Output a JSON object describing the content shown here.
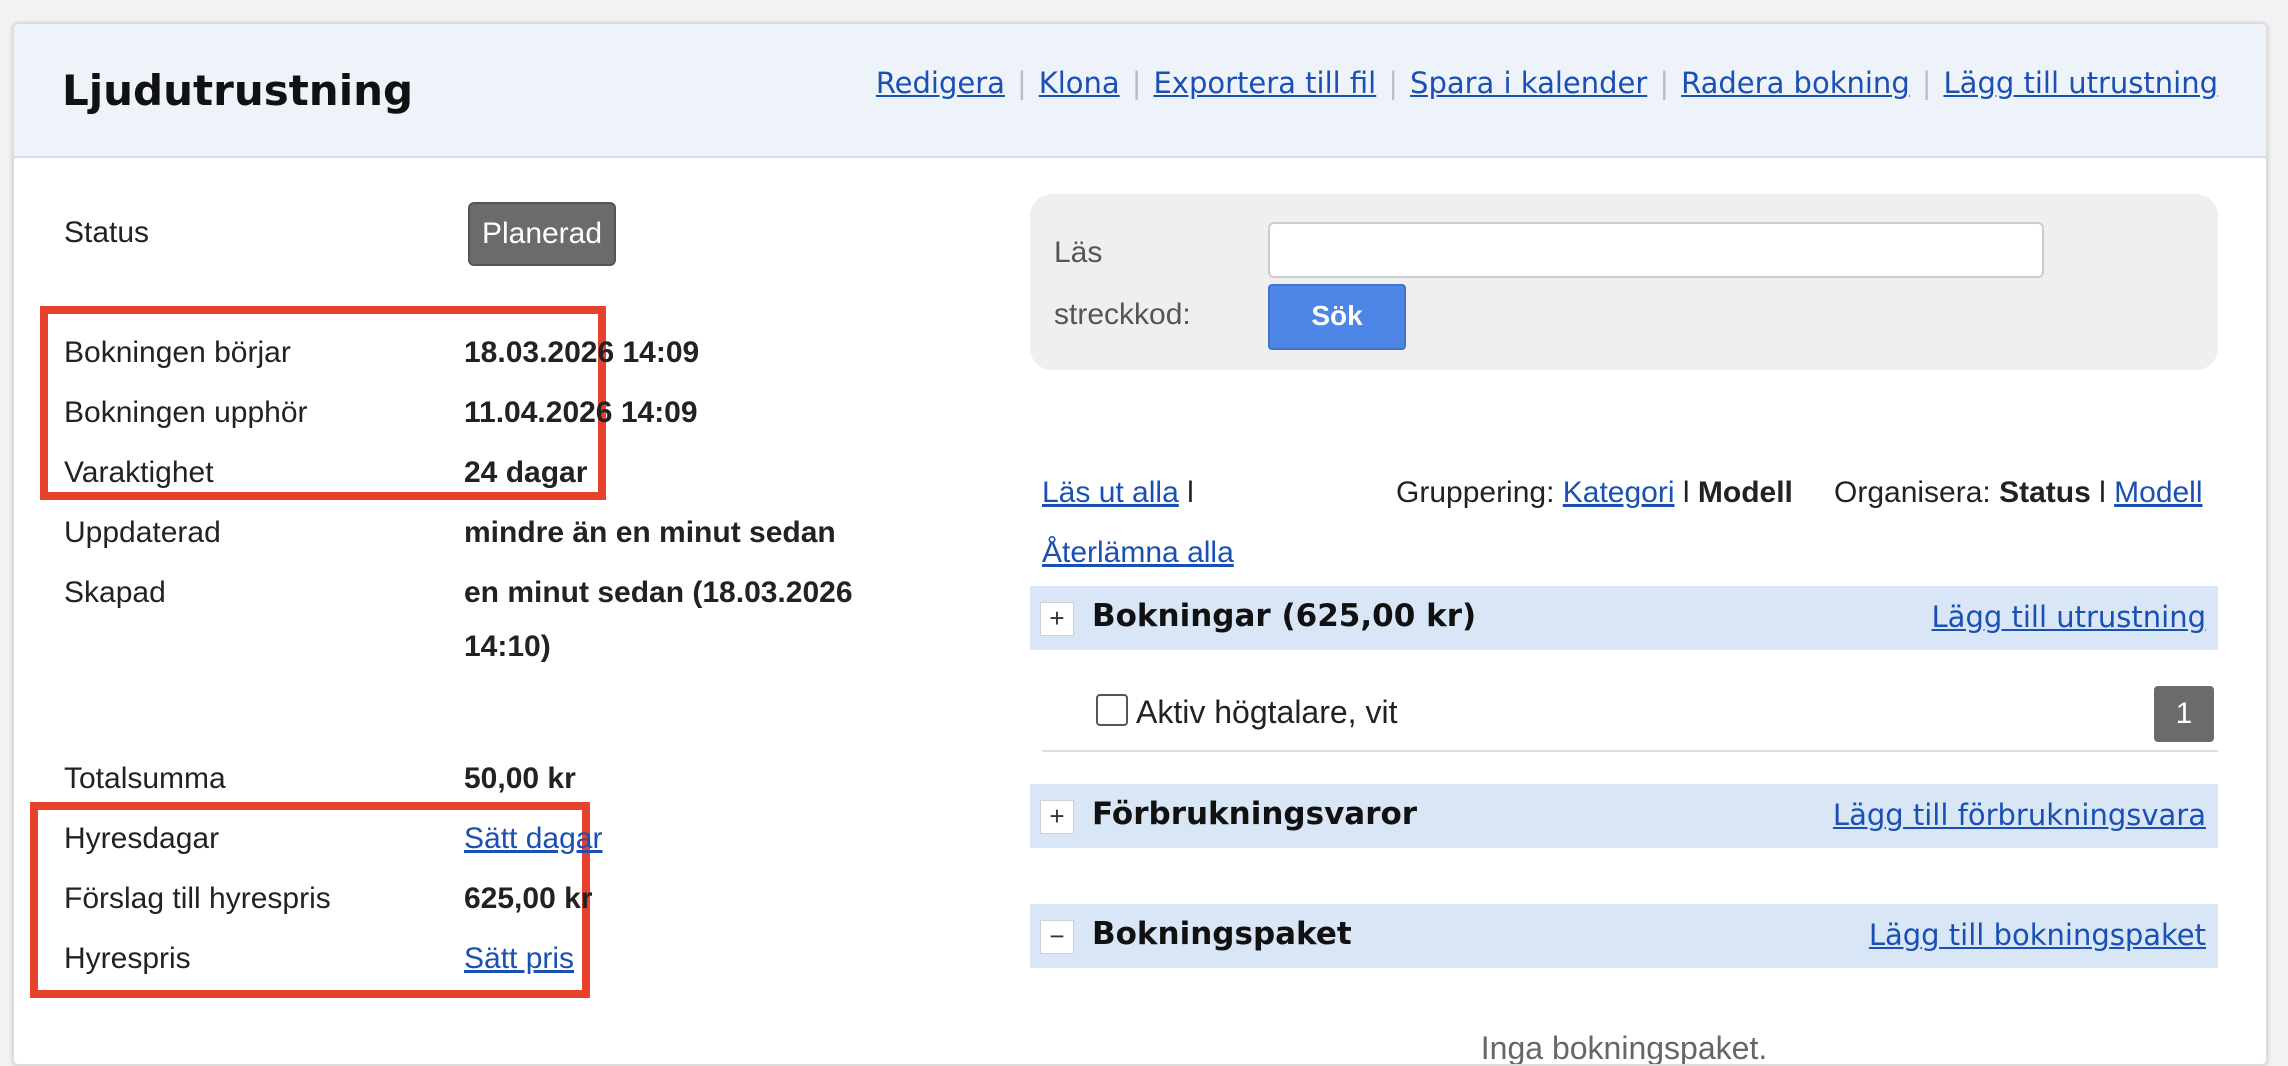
{
  "header": {
    "title": "Ljudutrustning",
    "actions": [
      "Redigera",
      "Klona",
      "Exportera till fil",
      "Spara i kalender",
      "Radera bokning",
      "Lägg till utrustning"
    ],
    "separator": "|"
  },
  "details": {
    "status": {
      "label": "Status",
      "value": "Planerad"
    },
    "start": {
      "label": "Bokningen börjar",
      "value": "18.03.2026 14:09"
    },
    "end": {
      "label": "Bokningen upphör",
      "value": "11.04.2026 14:09"
    },
    "duration": {
      "label": "Varaktighet",
      "value": "24 dagar"
    },
    "updated": {
      "label": "Uppdaterad",
      "value": "mindre än en minut sedan"
    },
    "created": {
      "label": "Skapad",
      "value_line1": "en minut sedan (18.03.2026",
      "value_line2": "14:10)"
    },
    "total": {
      "label": "Totalsumma",
      "value": "50,00 kr"
    },
    "rent_days": {
      "label": "Hyresdagar",
      "value": "Sätt dagar"
    },
    "suggested_price": {
      "label": "Förslag till hyrespris",
      "value": "625,00 kr"
    },
    "rent_price": {
      "label": "Hyrespris",
      "value": "Sätt pris"
    }
  },
  "scan": {
    "label": "Läs streckkod:",
    "input_value": "",
    "button": "Sök"
  },
  "toolbar": {
    "checkout_all": "Läs ut alla",
    "checkout_sep": "l",
    "return_all": "Återlämna alla",
    "grouping_label": "Gruppering:",
    "grouping_category": "Kategori",
    "grouping_sep": "l",
    "grouping_model": "Modell",
    "organize_label": "Organisera:",
    "organize_status": "Status",
    "organize_sep": "l",
    "organize_model": "Modell"
  },
  "sections": {
    "bookings": {
      "toggle": "+",
      "title": "Bokningar (625,00 kr)",
      "add": "Lägg till utrustning"
    },
    "consumables": {
      "toggle": "+",
      "title": "Förbrukningsvaror",
      "add": "Lägg till förbrukningsvara"
    },
    "packages": {
      "toggle": "−",
      "title": "Bokningspaket",
      "add": "Lägg till bokningspaket",
      "empty": "Inga bokningspaket."
    }
  },
  "items": [
    {
      "name": "Aktiv högtalare, vit",
      "quantity": "1",
      "checked": false
    }
  ],
  "colors": {
    "highlight": "#e8412b",
    "link": "#1a4fb3",
    "section_bg": "#d8e6f6",
    "button_blue": "#4d86e6",
    "badge_gray": "#6b6b6b"
  }
}
